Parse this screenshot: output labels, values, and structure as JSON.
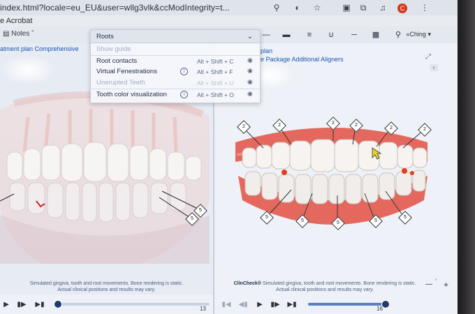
{
  "browser": {
    "url": "index.html?locale=eu_EU&user=wllg3vlk&ccModIntegrity=t...",
    "bookmark": "e Acrobat",
    "icons": [
      "zoom-icon",
      "eye-off-icon",
      "star-icon",
      "extension-icon",
      "puzzle-icon",
      "media-icon",
      "profile-icon",
      "menu-icon"
    ],
    "profile_letter": "C"
  },
  "toolbar": {
    "notes_label": "Notes",
    "user_label": "«Ching",
    "tool_icons": [
      "minus-icon",
      "bar-icon",
      "menu-lines-icon",
      "arc-icon",
      "line-icon",
      "grid-icon",
      "pin-icon"
    ]
  },
  "dropdown": {
    "selected": "Roots",
    "items": [
      {
        "label": "Show guide",
        "shortcut": "",
        "disabled": true,
        "info": false,
        "eye": false
      },
      {
        "label": "Root contacts",
        "shortcut": "Alt + Shift + C",
        "disabled": false,
        "info": false,
        "eye": true
      },
      {
        "label": "Virtual Fenestrations",
        "shortcut": "Alt + Shift + F",
        "disabled": false,
        "info": true,
        "eye": true
      },
      {
        "label": "Unerupted Teeth",
        "shortcut": "Alt + Shift + U",
        "disabled": true,
        "info": false,
        "eye": true
      },
      {
        "label": "Tooth color visualization",
        "shortcut": "Alt + Shift + O",
        "disabled": false,
        "info": true,
        "eye": true
      }
    ]
  },
  "left_pane": {
    "title": "atment plan  Comprehensive",
    "caption_brand": "",
    "caption_line1": "Simulated gingiva, tooth and root movements. Bone rendering is static.",
    "caption_line2": "Actual clinical positions and results may vary.",
    "badge_values": [
      "5",
      "5"
    ],
    "frame_counter": "13",
    "progress": 0.02
  },
  "right_pane": {
    "title": "plan",
    "subtitle": "e Package Additional Aligners",
    "caption_brand": "ClinCheck®",
    "caption_line1": "Simulated gingiva, tooth and root movements. Bone rendering is static.",
    "caption_line2": "Actual clinical positions and results may vary.",
    "upper_badges": [
      "2",
      "2",
      "2",
      "2",
      "2",
      "2"
    ],
    "lower_badges": [
      "5",
      "5",
      "5",
      "5",
      "5",
      "5"
    ],
    "frame_counter": "16",
    "progress": 1.0,
    "zoom_minus": "—",
    "zoom_plus": "+"
  },
  "colors": {
    "link_blue": "#1b56b0",
    "gum_red": "#e4685e",
    "tooth_white": "#f6f3f0"
  }
}
